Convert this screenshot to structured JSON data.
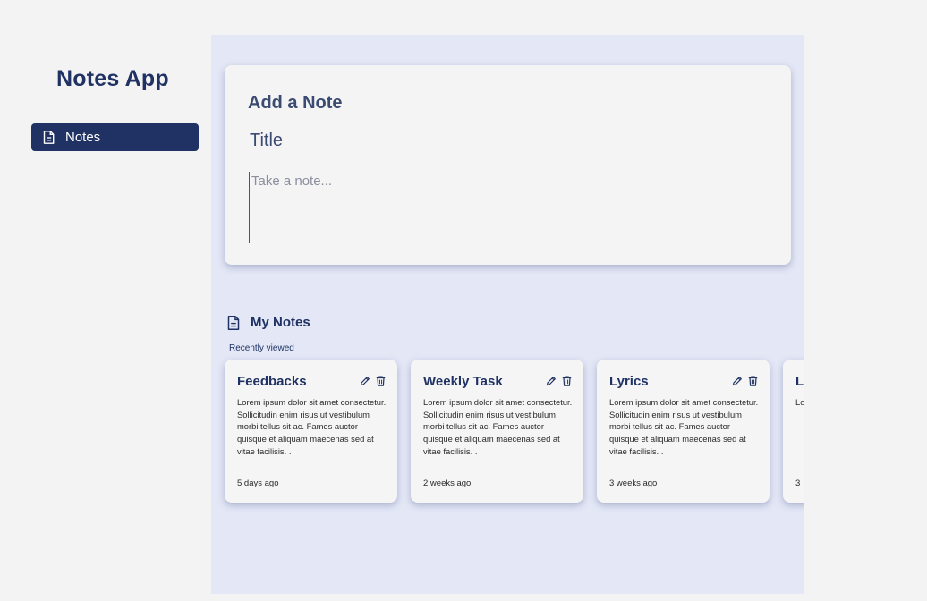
{
  "app": {
    "title": "Notes App"
  },
  "sidebar": {
    "items": [
      {
        "label": "Notes",
        "icon": "document-icon",
        "active": true
      }
    ]
  },
  "add_note": {
    "heading": "Add a Note",
    "title_placeholder": "Title",
    "note_placeholder": "Take a note..."
  },
  "my_notes": {
    "title": "My Notes",
    "subtitle": "Recently viewed",
    "notes": [
      {
        "title": "Feedbacks",
        "body": "Lorem ipsum dolor sit amet consectetur. Sollicitudin enim risus ut vestibulum morbi tellus sit ac. Fames auctor quisque et aliquam maecenas sed at vitae facilisis. .",
        "time": "5 days ago"
      },
      {
        "title": "Weekly Task",
        "body": "Lorem ipsum dolor sit amet consectetur. Sollicitudin enim risus ut vestibulum morbi tellus sit ac. Fames auctor quisque et aliquam maecenas sed at vitae facilisis. .",
        "time": "2 weeks ago"
      },
      {
        "title": "Lyrics",
        "body": "Lorem ipsum dolor sit amet consectetur. Sollicitudin enim risus ut vestibulum morbi tellus sit ac. Fames auctor quisque et aliquam maecenas sed at vitae facilisis. .",
        "time": "3 weeks ago"
      },
      {
        "title": "L",
        "body": "Lo co ris sit al fa",
        "time": "3"
      }
    ]
  },
  "colors": {
    "primary": "#1f3263",
    "page_background": "#f3f3f3",
    "main_background": "#e3e7f6",
    "card_background": "#f4f4f5"
  }
}
